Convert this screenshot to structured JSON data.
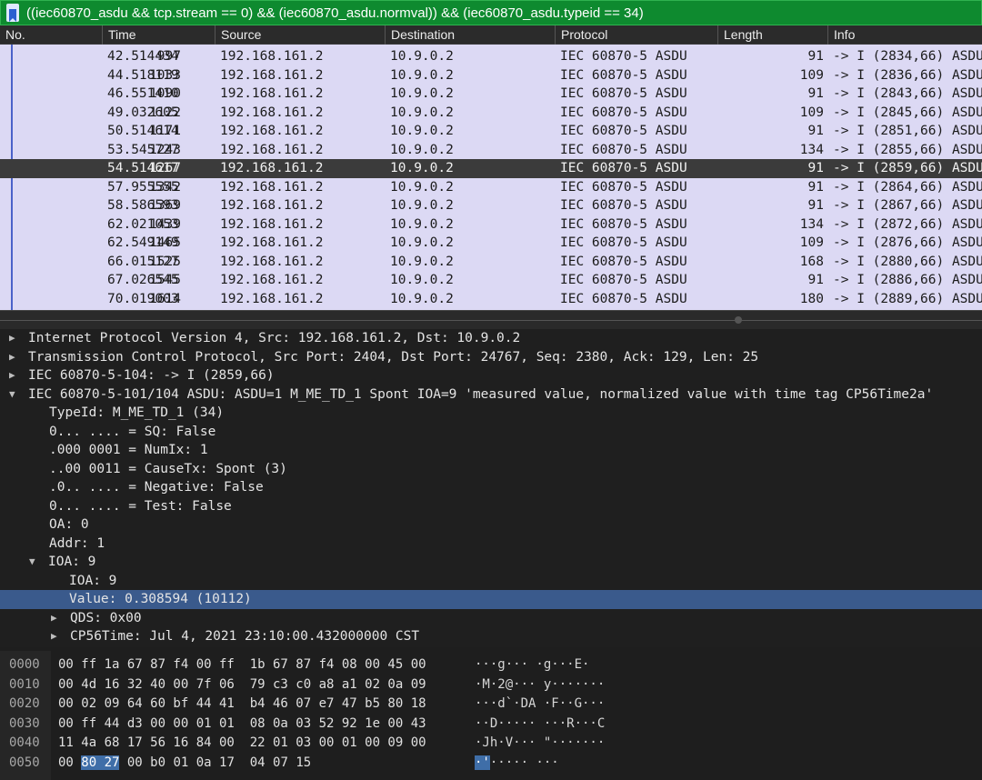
{
  "filter": {
    "text": "((iec60870_asdu && tcp.stream == 0) && (iec60870_asdu.normval)) && (iec60870_asdu.typeid == 34)"
  },
  "columns": {
    "no": "No.",
    "time": "Time",
    "source": "Source",
    "destination": "Destination",
    "protocol": "Protocol",
    "length": "Length",
    "info": "Info"
  },
  "packets": [
    {
      "no": "997",
      "time": "42.514434",
      "src": "192.168.161.2",
      "dst": "10.9.0.2",
      "proto": "IEC 60870-5 ASDU",
      "len": "91",
      "info": "-> I (2834,66) ASDU"
    },
    {
      "no": "1033",
      "time": "44.518119",
      "src": "192.168.161.2",
      "dst": "10.9.0.2",
      "proto": "IEC 60870-5 ASDU",
      "len": "109",
      "info": "-> I (2836,66) ASDU"
    },
    {
      "no": "1090",
      "time": "46.551410",
      "src": "192.168.161.2",
      "dst": "10.9.0.2",
      "proto": "IEC 60870-5 ASDU",
      "len": "91",
      "info": "-> I (2843,66) ASDU"
    },
    {
      "no": "1122",
      "time": "49.032605",
      "src": "192.168.161.2",
      "dst": "10.9.0.2",
      "proto": "IEC 60870-5 ASDU",
      "len": "109",
      "info": "-> I (2845,66) ASDU"
    },
    {
      "no": "1171",
      "time": "50.514614",
      "src": "192.168.161.2",
      "dst": "10.9.0.2",
      "proto": "IEC 60870-5 ASDU",
      "len": "91",
      "info": "-> I (2851,66) ASDU"
    },
    {
      "no": "1243",
      "time": "53.545727",
      "src": "192.168.161.2",
      "dst": "10.9.0.2",
      "proto": "IEC 60870-5 ASDU",
      "len": "134",
      "info": "-> I (2855,66) ASDU"
    },
    {
      "no": "1267",
      "time": "54.514617",
      "src": "192.168.161.2",
      "dst": "10.9.0.2",
      "proto": "IEC 60870-5 ASDU",
      "len": "91",
      "info": "-> I (2859,66) ASDU"
    },
    {
      "no": "1342",
      "time": "57.955555",
      "src": "192.168.161.2",
      "dst": "10.9.0.2",
      "proto": "IEC 60870-5 ASDU",
      "len": "91",
      "info": "-> I (2864,66) ASDU"
    },
    {
      "no": "1369",
      "time": "58.586593",
      "src": "192.168.161.2",
      "dst": "10.9.0.2",
      "proto": "IEC 60870-5 ASDU",
      "len": "91",
      "info": "-> I (2867,66) ASDU"
    },
    {
      "no": "1439",
      "time": "62.021053",
      "src": "192.168.161.2",
      "dst": "10.9.0.2",
      "proto": "IEC 60870-5 ASDU",
      "len": "134",
      "info": "-> I (2872,66) ASDU"
    },
    {
      "no": "1465",
      "time": "62.549149",
      "src": "192.168.161.2",
      "dst": "10.9.0.2",
      "proto": "IEC 60870-5 ASDU",
      "len": "109",
      "info": "-> I (2876,66) ASDU"
    },
    {
      "no": "1525",
      "time": "66.015127",
      "src": "192.168.161.2",
      "dst": "10.9.0.2",
      "proto": "IEC 60870-5 ASDU",
      "len": "168",
      "info": "-> I (2880,66) ASDU"
    },
    {
      "no": "1545",
      "time": "67.026545",
      "src": "192.168.161.2",
      "dst": "10.9.0.2",
      "proto": "IEC 60870-5 ASDU",
      "len": "91",
      "info": "-> I (2886,66) ASDU"
    },
    {
      "no": "1614",
      "time": "70.019003",
      "src": "192.168.161.2",
      "dst": "10.9.0.2",
      "proto": "IEC 60870-5 ASDU",
      "len": "180",
      "info": "-> I (2889,66) ASDU"
    }
  ],
  "details": [
    {
      "text": "Internet Protocol Version 4, Src: 192.168.161.2, Dst: 10.9.0.2",
      "tri": "▶"
    },
    {
      "text": "Transmission Control Protocol, Src Port: 2404, Dst Port: 24767, Seq: 2380, Ack: 129, Len: 25",
      "tri": "▶"
    },
    {
      "text": "IEC 60870-5-104: -> I (2859,66)",
      "tri": "▶"
    },
    {
      "text": "IEC 60870-5-101/104 ASDU: ASDU=1 M_ME_TD_1 Spont   IOA=9 'measured value, normalized value with time tag CP56Time2a'",
      "tri": "▼"
    },
    {
      "text": "TypeId: M_ME_TD_1 (34)",
      "tri": ""
    },
    {
      "text": "0... .... = SQ: False",
      "tri": ""
    },
    {
      "text": ".000 0001 = NumIx: 1",
      "tri": ""
    },
    {
      "text": "..00 0011 = CauseTx: Spont (3)",
      "tri": ""
    },
    {
      "text": ".0.. .... = Negative: False",
      "tri": ""
    },
    {
      "text": "0... .... = Test: False",
      "tri": ""
    },
    {
      "text": "OA: 0",
      "tri": ""
    },
    {
      "text": "Addr: 1",
      "tri": ""
    },
    {
      "text": "IOA: 9",
      "tri": "▼"
    },
    {
      "text": "IOA: 9",
      "tri": ""
    },
    {
      "text": "Value: 0.308594 (10112)",
      "tri": ""
    },
    {
      "text": "QDS: 0x00",
      "tri": "▶"
    },
    {
      "text": "CP56Time: Jul  4, 2021 23:10:00.432000000 CST",
      "tri": "▶"
    }
  ],
  "hex": [
    {
      "off": "0000",
      "bytes": "00 ff 1a 67 87 f4 00 ff  1b 67 87 f4 08 00 45 00",
      "ascii": "···g··· ·g···E·"
    },
    {
      "off": "0010",
      "bytes": "00 4d 16 32 40 00 7f 06  79 c3 c0 a8 a1 02 0a 09",
      "ascii": "·M·2@··· y·······"
    },
    {
      "off": "0020",
      "bytes": "00 02 09 64 60 bf 44 41  b4 46 07 e7 47 b5 80 18",
      "ascii": "···d`·DA ·F··G···"
    },
    {
      "off": "0030",
      "bytes": "00 ff 44 d3 00 00 01 01  08 0a 03 52 92 1e 00 43",
      "ascii": "··D····· ···R···C"
    },
    {
      "off": "0040",
      "bytes": "11 4a 68 17 56 16 84 00  22 01 03 00 01 00 09 00",
      "ascii": "·Jh·V··· \"·······"
    },
    {
      "off": "0050",
      "bytes_pre": "00 ",
      "bytes_hl": "80 27",
      "bytes_post": " 00 b0 01 0a 17  04 07 15",
      "ascii_pre": "",
      "ascii_hl": "·'",
      "ascii_post": "····· ···"
    }
  ]
}
